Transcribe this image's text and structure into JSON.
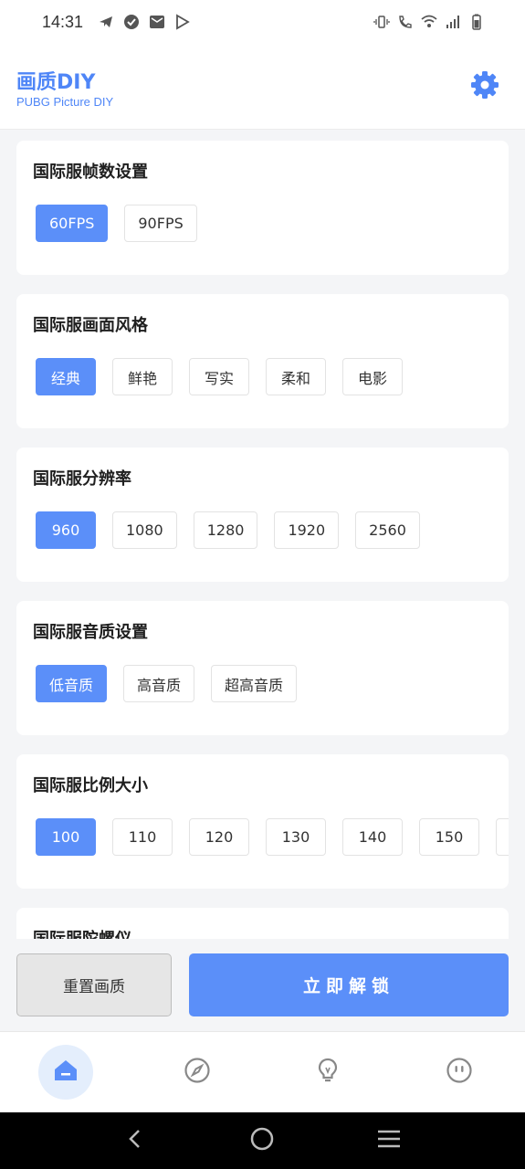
{
  "status_bar": {
    "time": "14:31",
    "left_icons": [
      "telegram-icon",
      "check-circle-icon",
      "mail-icon",
      "play-store-icon"
    ],
    "right_icons": [
      "vibrate-icon",
      "wifi-calling-icon",
      "wifi-icon",
      "signal-icon",
      "battery-icon"
    ]
  },
  "header": {
    "title": "画质DIY",
    "subtitle": "PUBG Picture DIY",
    "settings_icon": "gear-icon",
    "accent_color": "#4f86f7"
  },
  "sections": [
    {
      "title": "国际服帧数设置",
      "options": [
        "60FPS",
        "90FPS"
      ],
      "selected": "60FPS"
    },
    {
      "title": "国际服画面风格",
      "options": [
        "经典",
        "鲜艳",
        "写实",
        "柔和",
        "电影"
      ],
      "selected": "经典"
    },
    {
      "title": "国际服分辨率",
      "options": [
        "960",
        "1080",
        "1280",
        "1920",
        "2560"
      ],
      "selected": "960"
    },
    {
      "title": "国际服音质设置",
      "options": [
        "低音质",
        "高音质",
        "超高音质"
      ],
      "selected": "低音质"
    },
    {
      "title": "国际服比例大小",
      "options": [
        "100",
        "110",
        "120",
        "130",
        "140",
        "150"
      ],
      "selected": "100"
    },
    {
      "title": "国际服陀螺仪",
      "options": [],
      "selected": ""
    }
  ],
  "actions": {
    "reset_label": "重置画质",
    "unlock_label": "立即解锁"
  },
  "bottom_nav": {
    "items": [
      "home-icon",
      "compass-icon",
      "lightbulb-icon",
      "robot-face-icon"
    ],
    "active": "home-icon"
  },
  "system_nav": [
    "back-icon",
    "home-circle-icon",
    "menu-icon"
  ],
  "colors": {
    "primary": "#5b8ff9",
    "background": "#f4f5f7"
  }
}
